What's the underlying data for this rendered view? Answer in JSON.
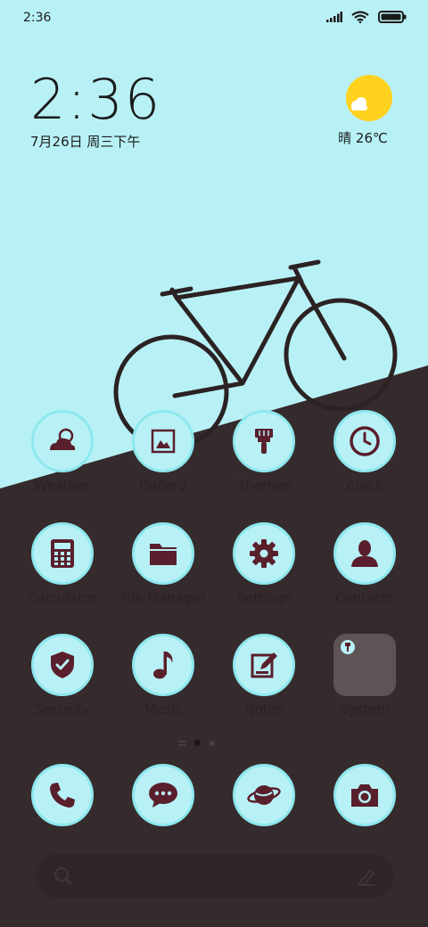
{
  "status_bar": {
    "time": "2:36",
    "icons": [
      "signal-icon",
      "wifi-icon",
      "battery-icon"
    ]
  },
  "clock_widget": {
    "time": "2:36",
    "date": "7月26日 周三下午"
  },
  "weather_widget": {
    "icon": "sun-cloud-icon",
    "text": "晴 26℃"
  },
  "apps": {
    "weather": {
      "label": "Weather",
      "icon": "cloud-moon-icon"
    },
    "gallery": {
      "label": "Gallery",
      "icon": "image-icon"
    },
    "themes": {
      "label": "Themes",
      "icon": "brush-icon"
    },
    "clock": {
      "label": "Clock",
      "icon": "clock-icon"
    },
    "calculator": {
      "label": "Calculator",
      "icon": "calculator-icon"
    },
    "file_manager": {
      "label": "File Manager",
      "icon": "folder-icon"
    },
    "settings": {
      "label": "Settings",
      "icon": "gear-icon"
    },
    "contacts": {
      "label": "Contacts",
      "icon": "person-icon"
    },
    "security": {
      "label": "Security",
      "icon": "shield-check-icon"
    },
    "music": {
      "label": "Music",
      "icon": "music-note-icon"
    },
    "notes": {
      "label": "Notes",
      "icon": "edit-note-icon"
    },
    "system": {
      "label": "System",
      "icon": "folder-grid-icon"
    }
  },
  "dock": [
    "phone-icon",
    "message-icon",
    "planet-icon",
    "camera-icon"
  ],
  "page_indicator": {
    "pages": 3,
    "current": 2
  },
  "search_bar": {
    "left_icon": "search-icon",
    "right_icon": "mic-icon"
  },
  "colors": {
    "sky": "#b8f1f5",
    "ground": "#352b2c",
    "icon_glyph": "#5a1f2c",
    "sun": "#ffd21f"
  }
}
